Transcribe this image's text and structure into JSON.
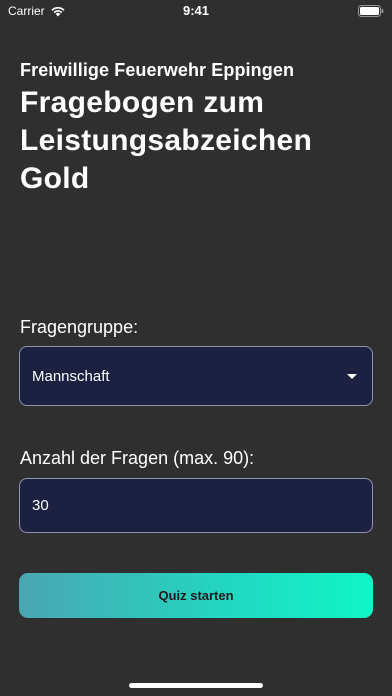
{
  "status_bar": {
    "carrier": "Carrier",
    "time": "9:41"
  },
  "header": {
    "organization": "Freiwillige Feuerwehr Eppingen",
    "title": "Fragebogen zum Leistungsabzeichen Gold"
  },
  "form": {
    "group_label": "Fragengruppe:",
    "group_selected": "Mannschaft",
    "count_label": "Anzahl der Fragen (max. 90):",
    "count_value": "30",
    "start_label": "Quiz starten"
  },
  "colors": {
    "background": "#2f2f2f",
    "field_background": "#1c2142",
    "button_gradient_start": "#4aa6b2",
    "button_gradient_end": "#10f6c6"
  },
  "icons": {
    "wifi": "wifi-icon",
    "battery": "battery-icon",
    "dropdown": "caret-down-icon"
  }
}
